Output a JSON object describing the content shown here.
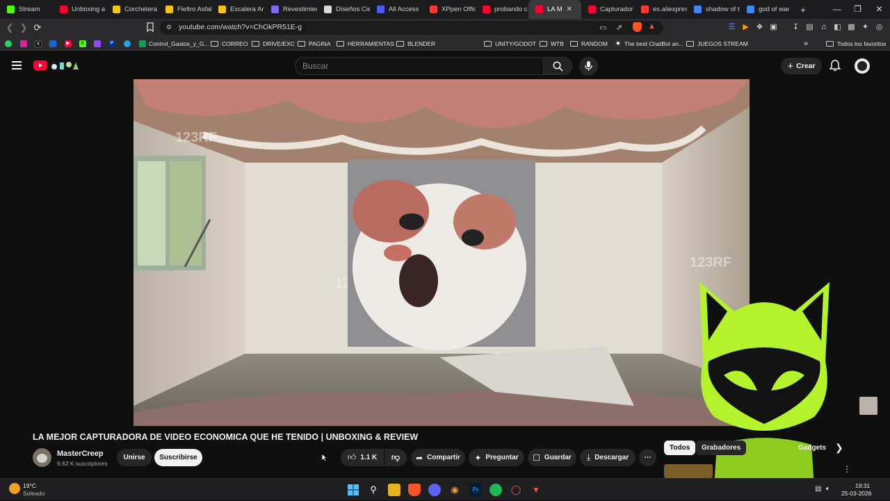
{
  "browser": {
    "tabs": [
      {
        "label": "Stream",
        "icon": "kick-icon",
        "color": "#53fc18"
      },
      {
        "label": "Unboxing a",
        "icon": "youtube-icon",
        "color": "#ff0033"
      },
      {
        "label": "Corchetera",
        "icon": "chrome-icon",
        "color": "#f0c419"
      },
      {
        "label": "Fieltro Asfal",
        "icon": "chrome-icon",
        "color": "#f0c419"
      },
      {
        "label": "Escalera Art",
        "icon": "chrome-icon",
        "color": "#f0c419"
      },
      {
        "label": "Revestimien",
        "icon": "arrow-icon",
        "color": "#7c6cf2"
      },
      {
        "label": "Diseños Cie",
        "icon": "r-icon",
        "color": "#d9d9d9"
      },
      {
        "label": "All Access",
        "icon": "x-icon",
        "color": "#4f5bff"
      },
      {
        "label": "XPpen Offic",
        "icon": "store-icon",
        "color": "#ff3b30"
      },
      {
        "label": "probando c",
        "icon": "youtube-icon",
        "color": "#ff0033"
      },
      {
        "label": "LA M",
        "icon": "youtube-icon",
        "color": "#ff0033",
        "active": true
      },
      {
        "label": "Capturador",
        "icon": "youtube-icon",
        "color": "#ff0033"
      },
      {
        "label": "es.aliexpres",
        "icon": "store-icon",
        "color": "#ff3b30"
      },
      {
        "label": "shadow of t",
        "icon": "google-icon",
        "color": "#4285f4"
      },
      {
        "label": "god of war",
        "icon": "google-icon",
        "color": "#4285f4"
      }
    ],
    "url": "youtube.com/watch?v=ChOkPR51E-g"
  },
  "bookmarks": {
    "items": [
      {
        "label": "Control_Gastos_y_G...",
        "type": "sheet"
      },
      {
        "label": "CORREO",
        "type": "folder"
      },
      {
        "label": "DRIVE/EXC",
        "type": "folder"
      },
      {
        "label": "PAGINA",
        "type": "folder"
      },
      {
        "label": "HERRAMIENTAS",
        "type": "folder"
      },
      {
        "label": "BLENDER",
        "type": "folder"
      },
      {
        "label": "UNITY/GODOT",
        "type": "folder"
      },
      {
        "label": "WTB",
        "type": "folder"
      },
      {
        "label": "RANDOM",
        "type": "folder"
      },
      {
        "label": "The best ChatBot an...",
        "type": "link"
      },
      {
        "label": "JUEGOS STREAM",
        "type": "folder"
      }
    ],
    "all_label": "Todos los favoritos"
  },
  "youtube": {
    "search_placeholder": "Buscar",
    "create_label": "Crear",
    "video_title": "LA MEJOR CAPTURADORA DE VIDEO ECONOMICA QUE HE TENIDO | UNBOXING & REVIEW",
    "channel_name": "MasterCreep",
    "subscribers": "9.62 K suscriptores",
    "join_label": "Unirse",
    "subscribe_label": "Suscribirse",
    "likes": "1.1 K",
    "share_label": "Compartir",
    "ask_label": "Preguntar",
    "save_label": "Guardar",
    "download_label": "Descargar",
    "chips": [
      "Todos",
      "Grabadores",
      "Gadgets"
    ],
    "watermark": "123RF"
  },
  "taskbar": {
    "temperature": "19°C",
    "weather": "Soleado",
    "time": "19:31",
    "date": "25-03-2026"
  }
}
